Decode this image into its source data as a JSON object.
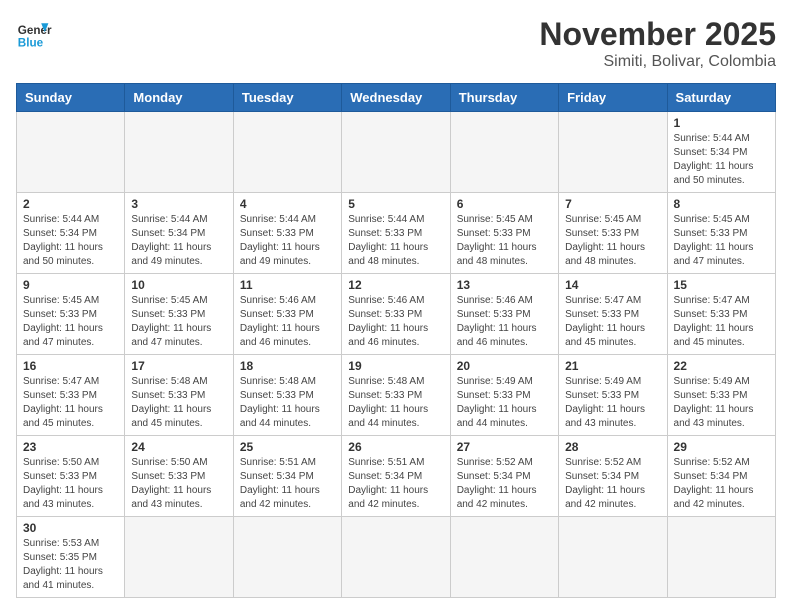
{
  "header": {
    "logo_general": "General",
    "logo_blue": "Blue",
    "title": "November 2025",
    "subtitle": "Simiti, Bolivar, Colombia"
  },
  "weekdays": [
    "Sunday",
    "Monday",
    "Tuesday",
    "Wednesday",
    "Thursday",
    "Friday",
    "Saturday"
  ],
  "weeks": [
    [
      {
        "day": "",
        "empty": true
      },
      {
        "day": "",
        "empty": true
      },
      {
        "day": "",
        "empty": true
      },
      {
        "day": "",
        "empty": true
      },
      {
        "day": "",
        "empty": true
      },
      {
        "day": "",
        "empty": true
      },
      {
        "day": "1",
        "sunrise": "Sunrise: 5:44 AM",
        "sunset": "Sunset: 5:34 PM",
        "daylight": "Daylight: 11 hours and 50 minutes."
      }
    ],
    [
      {
        "day": "2",
        "sunrise": "Sunrise: 5:44 AM",
        "sunset": "Sunset: 5:34 PM",
        "daylight": "Daylight: 11 hours and 50 minutes."
      },
      {
        "day": "3",
        "sunrise": "Sunrise: 5:44 AM",
        "sunset": "Sunset: 5:34 PM",
        "daylight": "Daylight: 11 hours and 49 minutes."
      },
      {
        "day": "4",
        "sunrise": "Sunrise: 5:44 AM",
        "sunset": "Sunset: 5:33 PM",
        "daylight": "Daylight: 11 hours and 49 minutes."
      },
      {
        "day": "5",
        "sunrise": "Sunrise: 5:44 AM",
        "sunset": "Sunset: 5:33 PM",
        "daylight": "Daylight: 11 hours and 48 minutes."
      },
      {
        "day": "6",
        "sunrise": "Sunrise: 5:45 AM",
        "sunset": "Sunset: 5:33 PM",
        "daylight": "Daylight: 11 hours and 48 minutes."
      },
      {
        "day": "7",
        "sunrise": "Sunrise: 5:45 AM",
        "sunset": "Sunset: 5:33 PM",
        "daylight": "Daylight: 11 hours and 48 minutes."
      },
      {
        "day": "8",
        "sunrise": "Sunrise: 5:45 AM",
        "sunset": "Sunset: 5:33 PM",
        "daylight": "Daylight: 11 hours and 47 minutes."
      }
    ],
    [
      {
        "day": "9",
        "sunrise": "Sunrise: 5:45 AM",
        "sunset": "Sunset: 5:33 PM",
        "daylight": "Daylight: 11 hours and 47 minutes."
      },
      {
        "day": "10",
        "sunrise": "Sunrise: 5:45 AM",
        "sunset": "Sunset: 5:33 PM",
        "daylight": "Daylight: 11 hours and 47 minutes."
      },
      {
        "day": "11",
        "sunrise": "Sunrise: 5:46 AM",
        "sunset": "Sunset: 5:33 PM",
        "daylight": "Daylight: 11 hours and 46 minutes."
      },
      {
        "day": "12",
        "sunrise": "Sunrise: 5:46 AM",
        "sunset": "Sunset: 5:33 PM",
        "daylight": "Daylight: 11 hours and 46 minutes."
      },
      {
        "day": "13",
        "sunrise": "Sunrise: 5:46 AM",
        "sunset": "Sunset: 5:33 PM",
        "daylight": "Daylight: 11 hours and 46 minutes."
      },
      {
        "day": "14",
        "sunrise": "Sunrise: 5:47 AM",
        "sunset": "Sunset: 5:33 PM",
        "daylight": "Daylight: 11 hours and 45 minutes."
      },
      {
        "day": "15",
        "sunrise": "Sunrise: 5:47 AM",
        "sunset": "Sunset: 5:33 PM",
        "daylight": "Daylight: 11 hours and 45 minutes."
      }
    ],
    [
      {
        "day": "16",
        "sunrise": "Sunrise: 5:47 AM",
        "sunset": "Sunset: 5:33 PM",
        "daylight": "Daylight: 11 hours and 45 minutes."
      },
      {
        "day": "17",
        "sunrise": "Sunrise: 5:48 AM",
        "sunset": "Sunset: 5:33 PM",
        "daylight": "Daylight: 11 hours and 45 minutes."
      },
      {
        "day": "18",
        "sunrise": "Sunrise: 5:48 AM",
        "sunset": "Sunset: 5:33 PM",
        "daylight": "Daylight: 11 hours and 44 minutes."
      },
      {
        "day": "19",
        "sunrise": "Sunrise: 5:48 AM",
        "sunset": "Sunset: 5:33 PM",
        "daylight": "Daylight: 11 hours and 44 minutes."
      },
      {
        "day": "20",
        "sunrise": "Sunrise: 5:49 AM",
        "sunset": "Sunset: 5:33 PM",
        "daylight": "Daylight: 11 hours and 44 minutes."
      },
      {
        "day": "21",
        "sunrise": "Sunrise: 5:49 AM",
        "sunset": "Sunset: 5:33 PM",
        "daylight": "Daylight: 11 hours and 43 minutes."
      },
      {
        "day": "22",
        "sunrise": "Sunrise: 5:49 AM",
        "sunset": "Sunset: 5:33 PM",
        "daylight": "Daylight: 11 hours and 43 minutes."
      }
    ],
    [
      {
        "day": "23",
        "sunrise": "Sunrise: 5:50 AM",
        "sunset": "Sunset: 5:33 PM",
        "daylight": "Daylight: 11 hours and 43 minutes."
      },
      {
        "day": "24",
        "sunrise": "Sunrise: 5:50 AM",
        "sunset": "Sunset: 5:33 PM",
        "daylight": "Daylight: 11 hours and 43 minutes."
      },
      {
        "day": "25",
        "sunrise": "Sunrise: 5:51 AM",
        "sunset": "Sunset: 5:34 PM",
        "daylight": "Daylight: 11 hours and 42 minutes."
      },
      {
        "day": "26",
        "sunrise": "Sunrise: 5:51 AM",
        "sunset": "Sunset: 5:34 PM",
        "daylight": "Daylight: 11 hours and 42 minutes."
      },
      {
        "day": "27",
        "sunrise": "Sunrise: 5:52 AM",
        "sunset": "Sunset: 5:34 PM",
        "daylight": "Daylight: 11 hours and 42 minutes."
      },
      {
        "day": "28",
        "sunrise": "Sunrise: 5:52 AM",
        "sunset": "Sunset: 5:34 PM",
        "daylight": "Daylight: 11 hours and 42 minutes."
      },
      {
        "day": "29",
        "sunrise": "Sunrise: 5:52 AM",
        "sunset": "Sunset: 5:34 PM",
        "daylight": "Daylight: 11 hours and 42 minutes."
      }
    ],
    [
      {
        "day": "30",
        "sunrise": "Sunrise: 5:53 AM",
        "sunset": "Sunset: 5:35 PM",
        "daylight": "Daylight: 11 hours and 41 minutes."
      },
      {
        "day": "",
        "empty": true
      },
      {
        "day": "",
        "empty": true
      },
      {
        "day": "",
        "empty": true
      },
      {
        "day": "",
        "empty": true
      },
      {
        "day": "",
        "empty": true
      },
      {
        "day": "",
        "empty": true
      }
    ]
  ]
}
